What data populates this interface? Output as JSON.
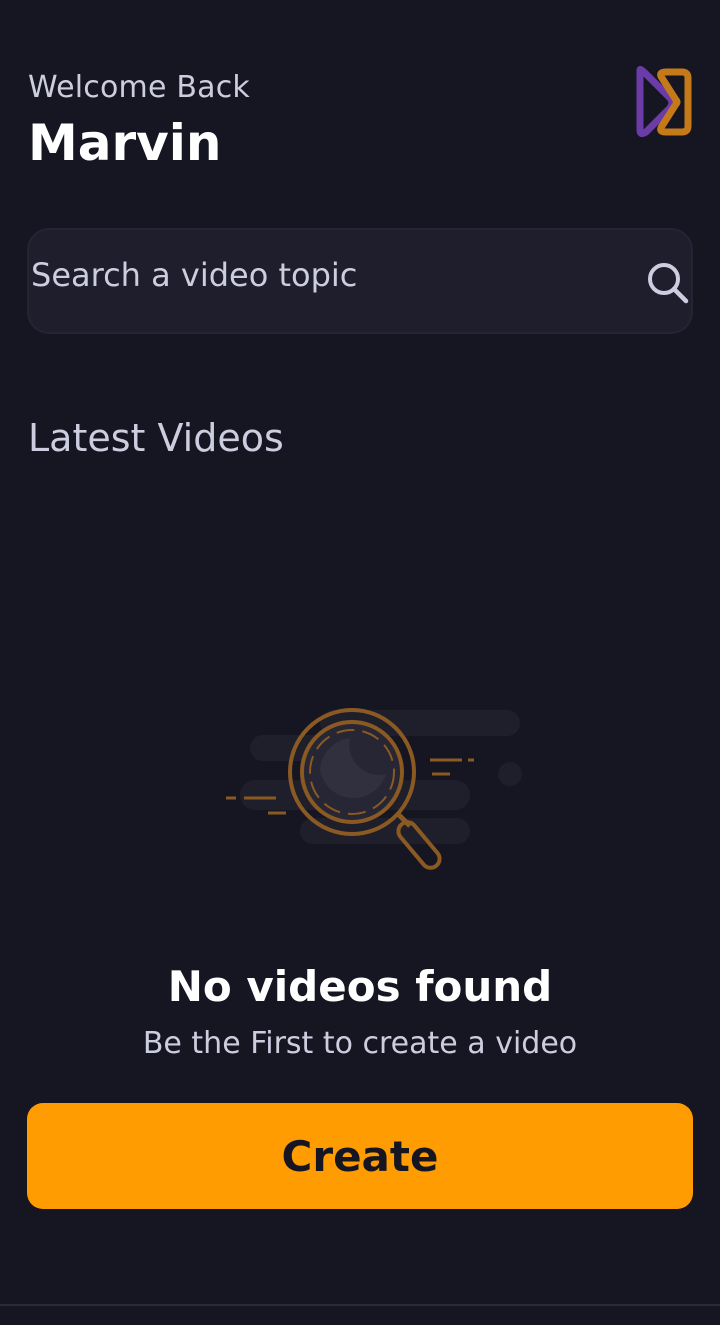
{
  "header": {
    "greeting": "Welcome Back",
    "username": "Marvin",
    "logo_icon": "play-logo-icon"
  },
  "search": {
    "placeholder": "Search a video topic",
    "icon": "search-icon"
  },
  "latest": {
    "title": "Latest Videos"
  },
  "empty_state": {
    "illustration": "magnifier-illustration",
    "title": "No videos found",
    "subtitle": "Be the First to create a video",
    "button_label": "Create"
  },
  "colors": {
    "background": "#161622",
    "accent": "#FF9C01",
    "logo_purple": "#6B3BA8",
    "logo_orange": "#C57A1A",
    "text_muted": "#CDCDE0",
    "search_bg": "#1E1E2D"
  }
}
